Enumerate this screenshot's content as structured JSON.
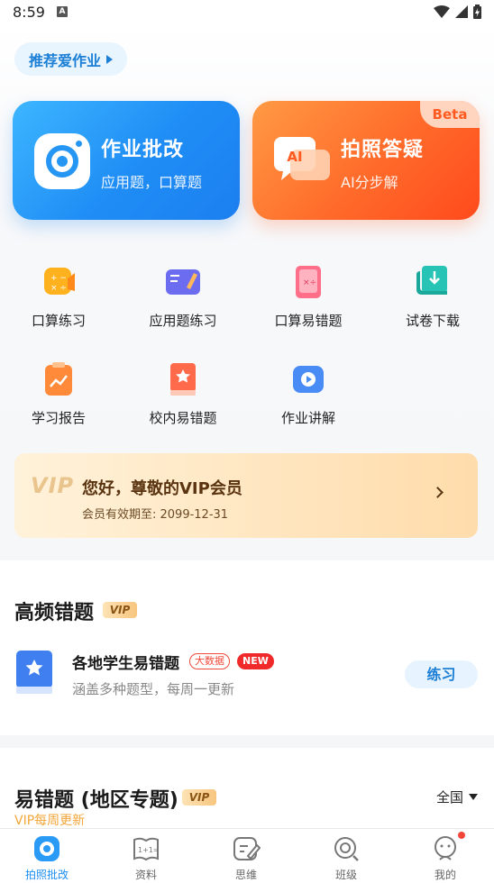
{
  "status_bar": {
    "time": "8:59",
    "notification_glyph": "A"
  },
  "recommend": {
    "label": "推荐爱作业"
  },
  "cards": [
    {
      "title": "作业批改",
      "subtitle": "应用题，口算题",
      "icon": "camera-icon",
      "color": "#1f8df5"
    },
    {
      "title": "拍照答疑",
      "subtitle": "AI分步解",
      "icon": "ai-chat-icon",
      "badge": "Beta",
      "icon_text": "AI",
      "color": "#ff6a2a"
    }
  ],
  "features": [
    {
      "label": "口算练习",
      "icon": "calculator-icon"
    },
    {
      "label": "应用题练习",
      "icon": "book-pencil-icon"
    },
    {
      "label": "口算易错题",
      "icon": "error-book-icon"
    },
    {
      "label": "试卷下载",
      "icon": "download-icon"
    },
    {
      "label": "学习报告",
      "icon": "report-icon"
    },
    {
      "label": "校内易错题",
      "icon": "star-book-icon"
    },
    {
      "label": "作业讲解",
      "icon": "video-icon"
    }
  ],
  "vip": {
    "logo": "VIP",
    "greeting": "您好，尊敬的VIP会员",
    "expiry": "会员有效期至: 2099-12-31"
  },
  "high_freq": {
    "title": "高频错题",
    "vip_tag": "VIP",
    "item": {
      "title": "各地学生易错题",
      "tag_bigdata": "大数据",
      "tag_new": "NEW",
      "desc": "涵盖多种题型，每周一更新",
      "button": "练习"
    }
  },
  "regional": {
    "title": "易错题 (地区专题)",
    "vip_tag": "VIP",
    "region": "全国",
    "note": "VIP每周更新"
  },
  "tabs": [
    {
      "label": "拍照批改",
      "icon": "camera-tab-icon",
      "active": true
    },
    {
      "label": "资料",
      "icon": "book-tab-icon"
    },
    {
      "label": "思维",
      "icon": "edit-tab-icon"
    },
    {
      "label": "班级",
      "icon": "class-tab-icon"
    },
    {
      "label": "我的",
      "icon": "profile-tab-icon"
    }
  ],
  "colors": {
    "primary": "#1c8ef0",
    "accent_orange": "#ff6a2a",
    "vip_gold": "#e9c48c",
    "badge_red": "#f02a2a"
  }
}
